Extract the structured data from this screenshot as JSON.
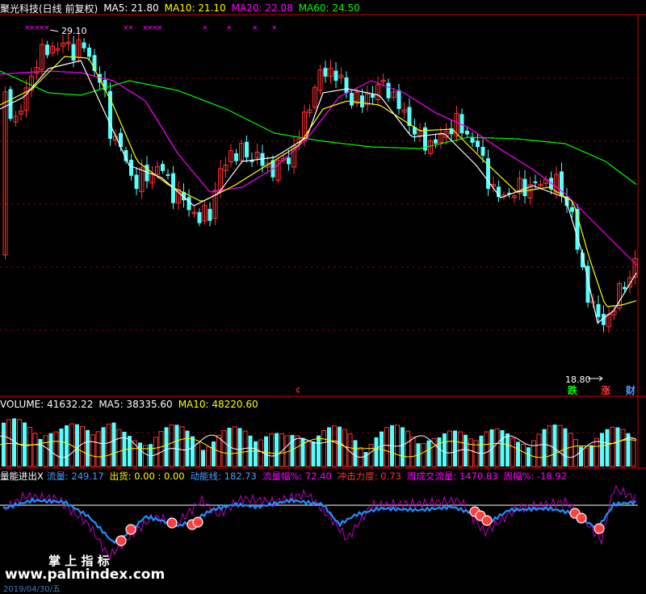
{
  "header": {
    "title": "聚光科技(日线 前复权)",
    "ma5": "MA5: 21.80",
    "ma10": "MA10: 21.10",
    "ma20": "MA20: 22.08",
    "ma60": "MA60: 24.50"
  },
  "price_annotations": {
    "high": "29.10",
    "low": "18.80",
    "marker": "¢"
  },
  "buttons": {
    "down": "跌",
    "up": "涨",
    "finance": "财"
  },
  "volume_header": {
    "volume": "VOLUME: 41632.22",
    "ma5": "MA5: 38335.60",
    "ma10": "MA10: 48220.60"
  },
  "indicator_header": {
    "name": "量能进出X",
    "flow": "流量: 249.17",
    "out": "出货: 0.00 : 0.00",
    "momentum": "动能线: 182.73",
    "flow_amp": "流量幅%: 72.40",
    "impact": "冲击力度: 0.73",
    "weekly_vol": "周成交流量: 1470.83",
    "weekly_amp": "周幅%: -18.92"
  },
  "watermark": {
    "label": "掌 上 指 标",
    "url": "www.palmindex.com",
    "date": "2019/04/30/五"
  },
  "colors": {
    "bg": "#000000",
    "up": "#ff3232",
    "down": "#54ffff",
    "ma5": "#ffffff",
    "ma10": "#ffff00",
    "ma20": "#ff00ff",
    "ma60": "#00ff00",
    "grid": "#b00000",
    "frame": "#cc0000",
    "flow": "#1e90ff",
    "amp": "#c000c0"
  },
  "chart_data": {
    "type": "candlestick",
    "price_range": [
      18.8,
      29.1
    ],
    "ma_lines": [
      "MA5",
      "MA10",
      "MA20",
      "MA60"
    ],
    "series_last": {
      "MA5": 21.8,
      "MA10": 21.1,
      "MA20": 22.08,
      "MA60": 24.5
    },
    "volume_last": {
      "VOLUME": 41632.22,
      "MA5": 38335.6,
      "MA10": 48220.6
    },
    "indicator_last": {
      "流量": 249.17,
      "动能线": 182.73,
      "流量幅%": 72.4,
      "冲击力度": 0.73,
      "周成交流量": 1470.83,
      "周幅%": -18.92
    }
  }
}
